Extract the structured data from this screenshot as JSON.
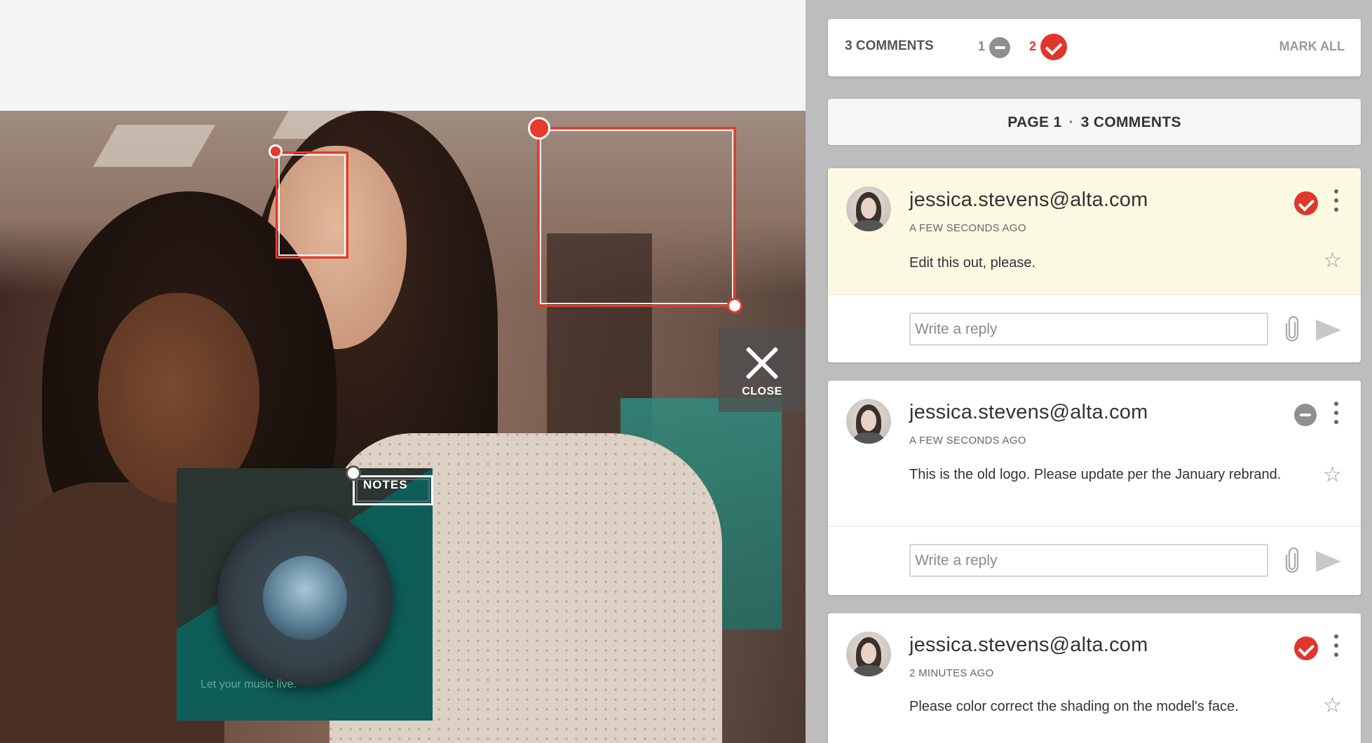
{
  "viewer": {
    "close_label": "CLOSE",
    "notes_label": "NOTES",
    "box_text": "Let your music live."
  },
  "summary": {
    "count_label": "3 COMMENTS",
    "open_count": "1",
    "resolved_count": "2",
    "mark_all_label": "MARK ALL"
  },
  "page_header": {
    "page": "PAGE 1",
    "separator": "·",
    "comments": "3 COMMENTS"
  },
  "comments": [
    {
      "author": "jessica.stevens@alta.com",
      "time": "A FEW SECONDS AGO",
      "text": "Edit this out, please.",
      "status": "resolved",
      "reply_placeholder": "Write a reply"
    },
    {
      "author": "jessica.stevens@alta.com",
      "time": "A FEW SECONDS AGO",
      "text": "This is the old logo. Please update per the January rebrand.",
      "status": "open",
      "reply_placeholder": "Write a reply"
    },
    {
      "author": "jessica.stevens@alta.com",
      "time": "2 MINUTES AGO",
      "text": "Please color correct the shading on the model's face.",
      "status": "resolved"
    }
  ],
  "colors": {
    "accent_red": "#e0362c",
    "highlight_bg": "#fcf9e3",
    "panel_bg": "#bdbdbd"
  },
  "icons": [
    "close-icon",
    "minus-circle-icon",
    "check-circle-icon",
    "kebab-menu-icon",
    "star-icon",
    "paperclip-icon",
    "send-icon"
  ]
}
